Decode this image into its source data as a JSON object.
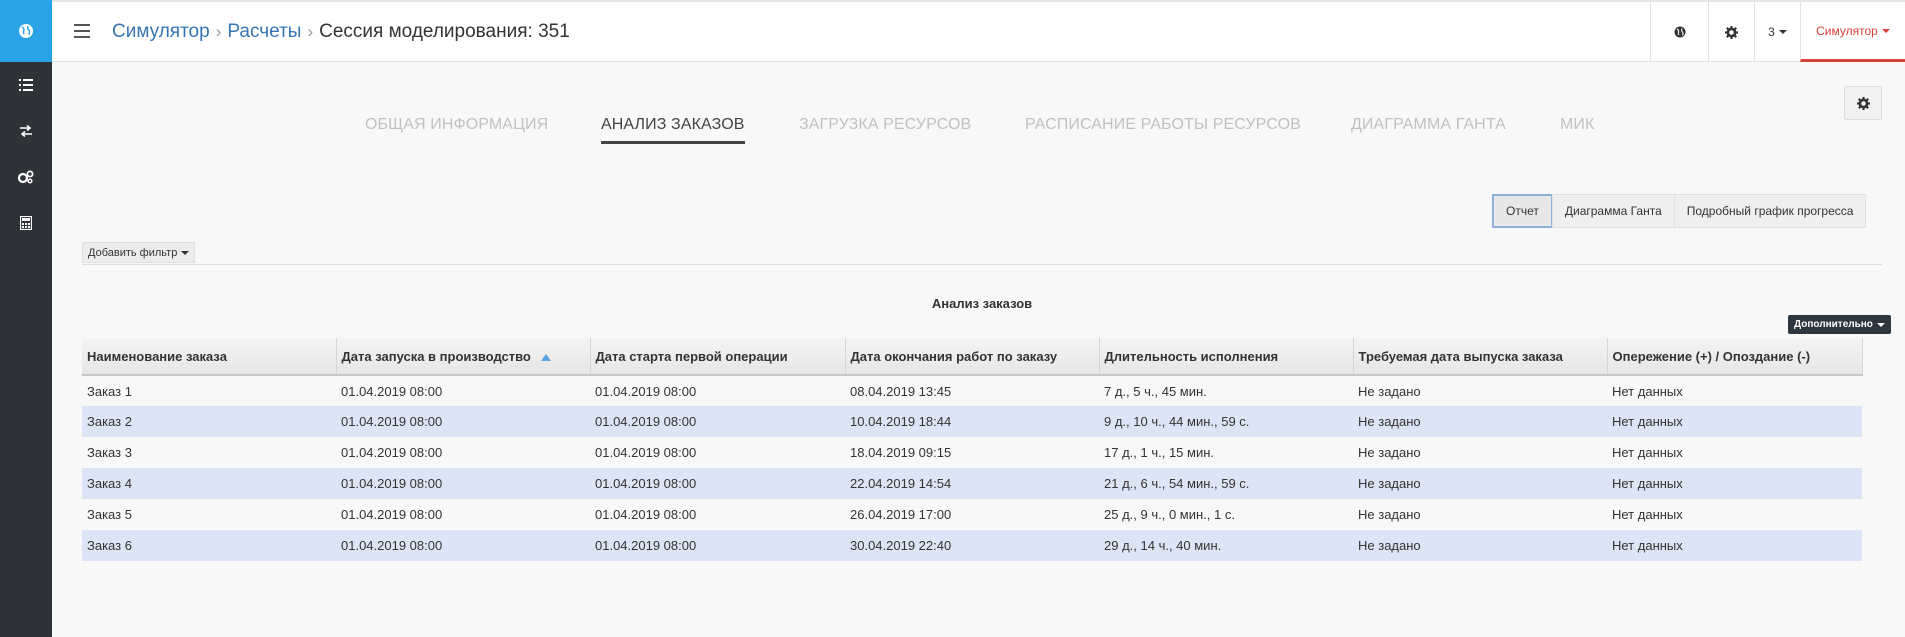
{
  "sidebar": {
    "logo_icon": "globe-icon",
    "items": [
      {
        "icon": "list-icon"
      },
      {
        "icon": "exchange-icon"
      },
      {
        "icon": "gears-icon"
      },
      {
        "icon": "calculator-icon"
      }
    ]
  },
  "breadcrumb": {
    "items": [
      "Симулятор",
      "Расчеты"
    ],
    "current": "Сессия моделирования: 351"
  },
  "topbar": {
    "count_label": "3",
    "user_label": "Симулятор"
  },
  "tabs": [
    {
      "label": "ОБЩАЯ ИНФОРМАЦИЯ",
      "active": false
    },
    {
      "label": "АНАЛИЗ ЗАКАЗОВ",
      "active": true
    },
    {
      "label": "ЗАГРУЗКА РЕСУРСОВ",
      "active": false
    },
    {
      "label": "РАСПИСАНИЕ РАБОТЫ РЕСУРСОВ",
      "active": false
    },
    {
      "label": "ДИАГРАММА ГАНТА",
      "active": false
    },
    {
      "label": "МИК",
      "active": false
    }
  ],
  "view_buttons": [
    {
      "label": "Отчет",
      "active": true
    },
    {
      "label": "Диаграмма Ганта",
      "active": false
    },
    {
      "label": "Подробный график прогресса",
      "active": false
    }
  ],
  "filter": {
    "add_label": "Добавить фильтр"
  },
  "table": {
    "title": "Анализ заказов",
    "more_label": "Дополнительно",
    "columns": [
      "Наименование заказа",
      "Дата запуска в производство",
      "Дата старта первой операции",
      "Дата окончания работ по заказу",
      "Длительность исполнения",
      "Требуемая дата выпуска заказа",
      "Опережение (+) / Опоздание (-)"
    ],
    "sorted_column": 1,
    "rows": [
      [
        "Заказ 1",
        "01.04.2019 08:00",
        "01.04.2019 08:00",
        "08.04.2019 13:45",
        "7 д., 5 ч., 45 мин.",
        "Не задано",
        "Нет данных"
      ],
      [
        "Заказ 2",
        "01.04.2019 08:00",
        "01.04.2019 08:00",
        "10.04.2019 18:44",
        "9 д., 10 ч., 44 мин., 59 с.",
        "Не задано",
        "Нет данных"
      ],
      [
        "Заказ 3",
        "01.04.2019 08:00",
        "01.04.2019 08:00",
        "18.04.2019 09:15",
        "17 д., 1 ч., 15 мин.",
        "Не задано",
        "Нет данных"
      ],
      [
        "Заказ 4",
        "01.04.2019 08:00",
        "01.04.2019 08:00",
        "22.04.2019 14:54",
        "21 д., 6 ч., 54 мин., 59 с.",
        "Не задано",
        "Нет данных"
      ],
      [
        "Заказ 5",
        "01.04.2019 08:00",
        "01.04.2019 08:00",
        "26.04.2019 17:00",
        "25 д., 9 ч., 0 мин., 1 с.",
        "Не задано",
        "Нет данных"
      ],
      [
        "Заказ 6",
        "01.04.2019 08:00",
        "01.04.2019 08:00",
        "30.04.2019 22:40",
        "29 д., 14 ч., 40 мин.",
        "Не задано",
        "Нет данных"
      ]
    ]
  },
  "colors": {
    "sidebar_bg": "#2f3338",
    "logo_bg": "#29a3e6",
    "link": "#3875b5",
    "user_accent": "#d9433a",
    "row_stripe": "#dce5f6"
  }
}
